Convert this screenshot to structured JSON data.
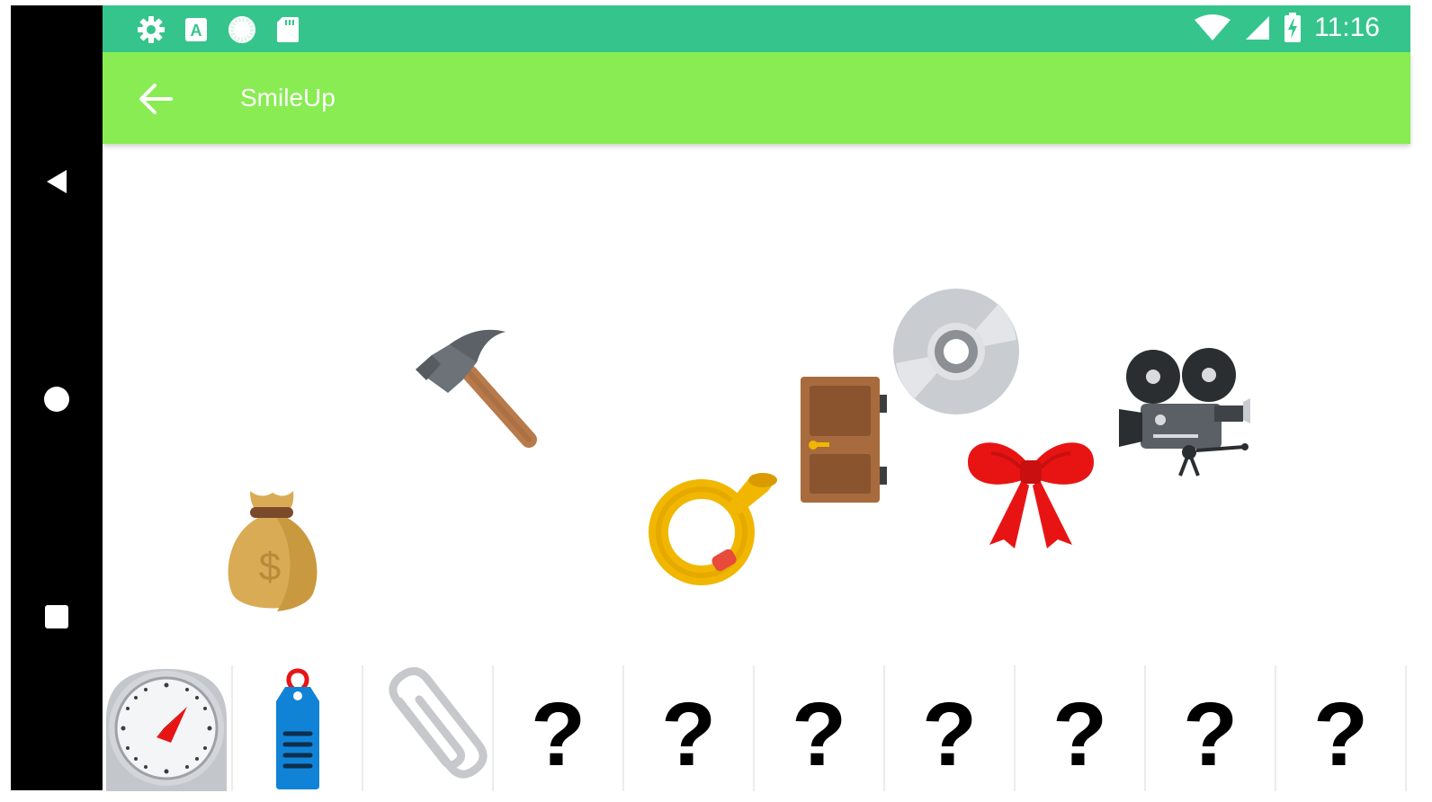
{
  "status_bar": {
    "time": "11:16",
    "left_icons": [
      "gear-icon",
      "keyboard-a-icon",
      "sync-circle-icon",
      "sd-card-icon"
    ],
    "right_icons": [
      "wifi-icon",
      "signal-icon",
      "battery-charging-icon"
    ]
  },
  "nav_bar": {
    "buttons": [
      "back-triangle-icon",
      "home-circle-icon",
      "recents-square-icon"
    ]
  },
  "app_bar": {
    "title": "SmileUp",
    "back_icon": "arrow-back-icon",
    "color": "#88ec52"
  },
  "scene": {
    "items": [
      "money-bag",
      "hammer",
      "postal-horn",
      "door",
      "optical-disc",
      "red-ribbon-bow",
      "movie-camera"
    ]
  },
  "tray": {
    "found_items": [
      "stopwatch",
      "blue-tag",
      "paperclip"
    ],
    "unknown_slots": [
      "?",
      "?",
      "?",
      "?",
      "?",
      "?",
      "?"
    ]
  },
  "colors": {
    "status_bar": "#35c58c",
    "app_bar": "#88ec52",
    "nav_bar": "#000000"
  }
}
